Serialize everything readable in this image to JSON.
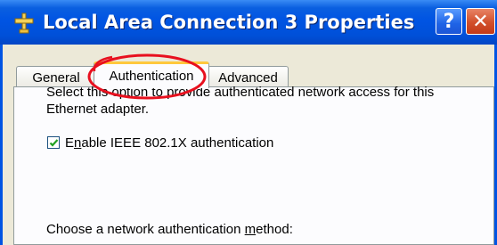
{
  "window": {
    "title": "Local Area Connection 3 Properties",
    "help_button": "?",
    "close_button": "✕"
  },
  "tabs": [
    {
      "label": "General",
      "active": false
    },
    {
      "label": "Authentication",
      "active": true
    },
    {
      "label": "Advanced",
      "active": false
    }
  ],
  "authentication": {
    "description": "Select this option to provide authenticated network access for this Ethernet adapter.",
    "enable_8021x": {
      "label_prefix": "E",
      "label_accesskey": "n",
      "label_rest": "able IEEE 802.1X authentication",
      "checked": true
    },
    "method_label_prefix": "Choose a network authentication ",
    "method_label_accesskey": "m",
    "method_label_rest": "ethod:"
  },
  "annotation": {
    "color": "#e8101e"
  }
}
